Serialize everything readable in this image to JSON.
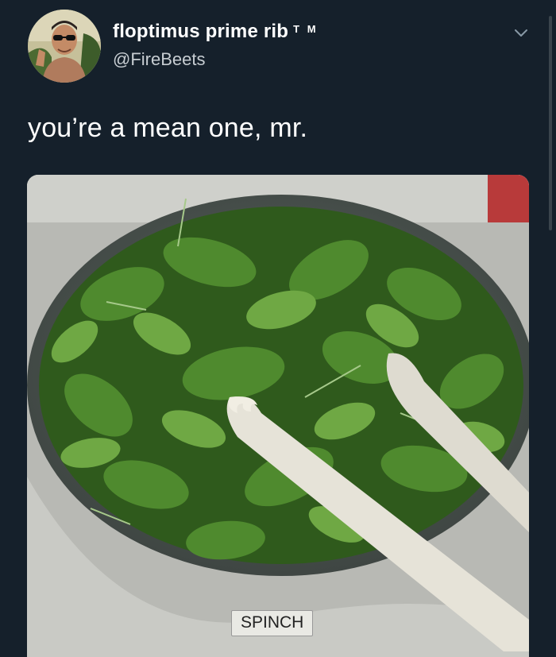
{
  "tweet": {
    "display_name": "floptimus prime rib",
    "name_suffix": "T M",
    "handle": "@FireBeets",
    "text": "you’re a mean one, mr.",
    "menu_icon": "chevron-down-icon"
  },
  "media": {
    "label_text": "SPINCH"
  }
}
